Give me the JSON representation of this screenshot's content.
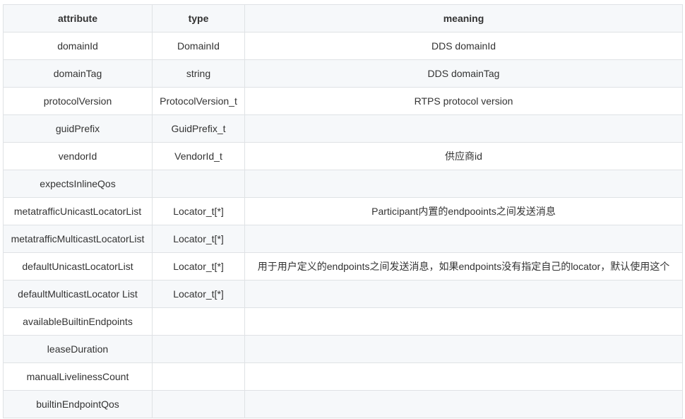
{
  "table": {
    "headers": [
      "attribute",
      "type",
      "meaning"
    ],
    "rows": [
      [
        "domainId",
        "DomainId",
        "DDS domainId"
      ],
      [
        "domainTag",
        "string",
        "DDS domainTag"
      ],
      [
        "protocolVersion",
        "ProtocolVersion_t",
        "RTPS protocol version"
      ],
      [
        "guidPrefix",
        "GuidPrefix_t",
        ""
      ],
      [
        "vendorId",
        "VendorId_t",
        "供应商id"
      ],
      [
        "expectsInlineQos",
        "",
        ""
      ],
      [
        "metatrafficUnicastLocatorList",
        "Locator_t[*]",
        "Participant内置的endpooints之间发送消息"
      ],
      [
        "metatrafficMulticastLocatorList",
        "Locator_t[*]",
        ""
      ],
      [
        "defaultUnicastLocatorList",
        "Locator_t[*]",
        "用于用户定义的endpoints之间发送消息，如果endpoints没有指定自己的locator，默认使用这个"
      ],
      [
        "defaultMulticastLocator List",
        "Locator_t[*]",
        ""
      ],
      [
        "availableBuiltinEndpoints",
        "",
        ""
      ],
      [
        "leaseDuration",
        "",
        ""
      ],
      [
        "manualLivelinessCount",
        "",
        ""
      ],
      [
        "builtinEndpointQos",
        "",
        ""
      ]
    ]
  }
}
